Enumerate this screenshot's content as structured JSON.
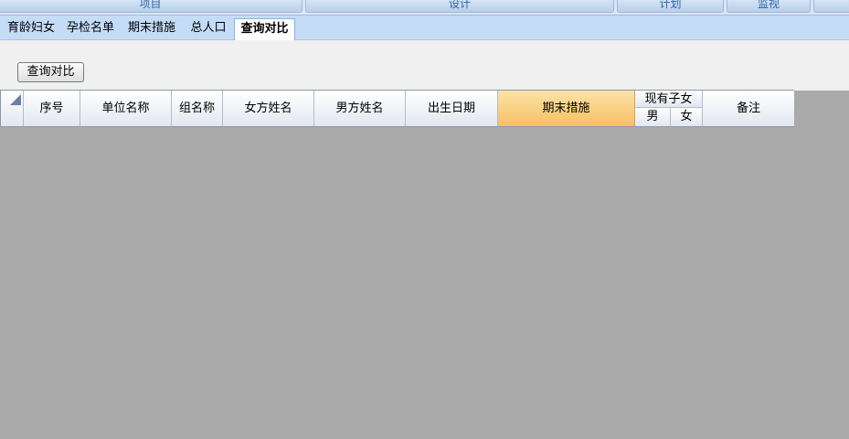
{
  "top_menu": [
    {
      "label": "项目"
    },
    {
      "label": "设计"
    },
    {
      "label": "计划"
    },
    {
      "label": "监视"
    },
    {
      "label": ""
    }
  ],
  "tabs": [
    {
      "label": "育龄妇女",
      "active": false
    },
    {
      "label": "孕检名单",
      "active": false
    },
    {
      "label": "期末措施",
      "active": false
    },
    {
      "label": "总人口",
      "active": false
    },
    {
      "label": "查询对比",
      "active": true
    }
  ],
  "toolbar": {
    "query_button": "查询对比"
  },
  "grid": {
    "columns": {
      "seq": "序号",
      "unit_name": "单位名称",
      "group_name": "组名称",
      "wife_name": "女方姓名",
      "husband_name": "男方姓名",
      "birth_date": "出生日期",
      "end_measure": "期末措施",
      "current_children": "现有子女",
      "male": "男",
      "female": "女",
      "remarks": "备注"
    },
    "rows": []
  },
  "colors": {
    "background": "#aaaaaa",
    "tabbar": "#c4dcf6",
    "highlight_header": "#f6bf62"
  }
}
